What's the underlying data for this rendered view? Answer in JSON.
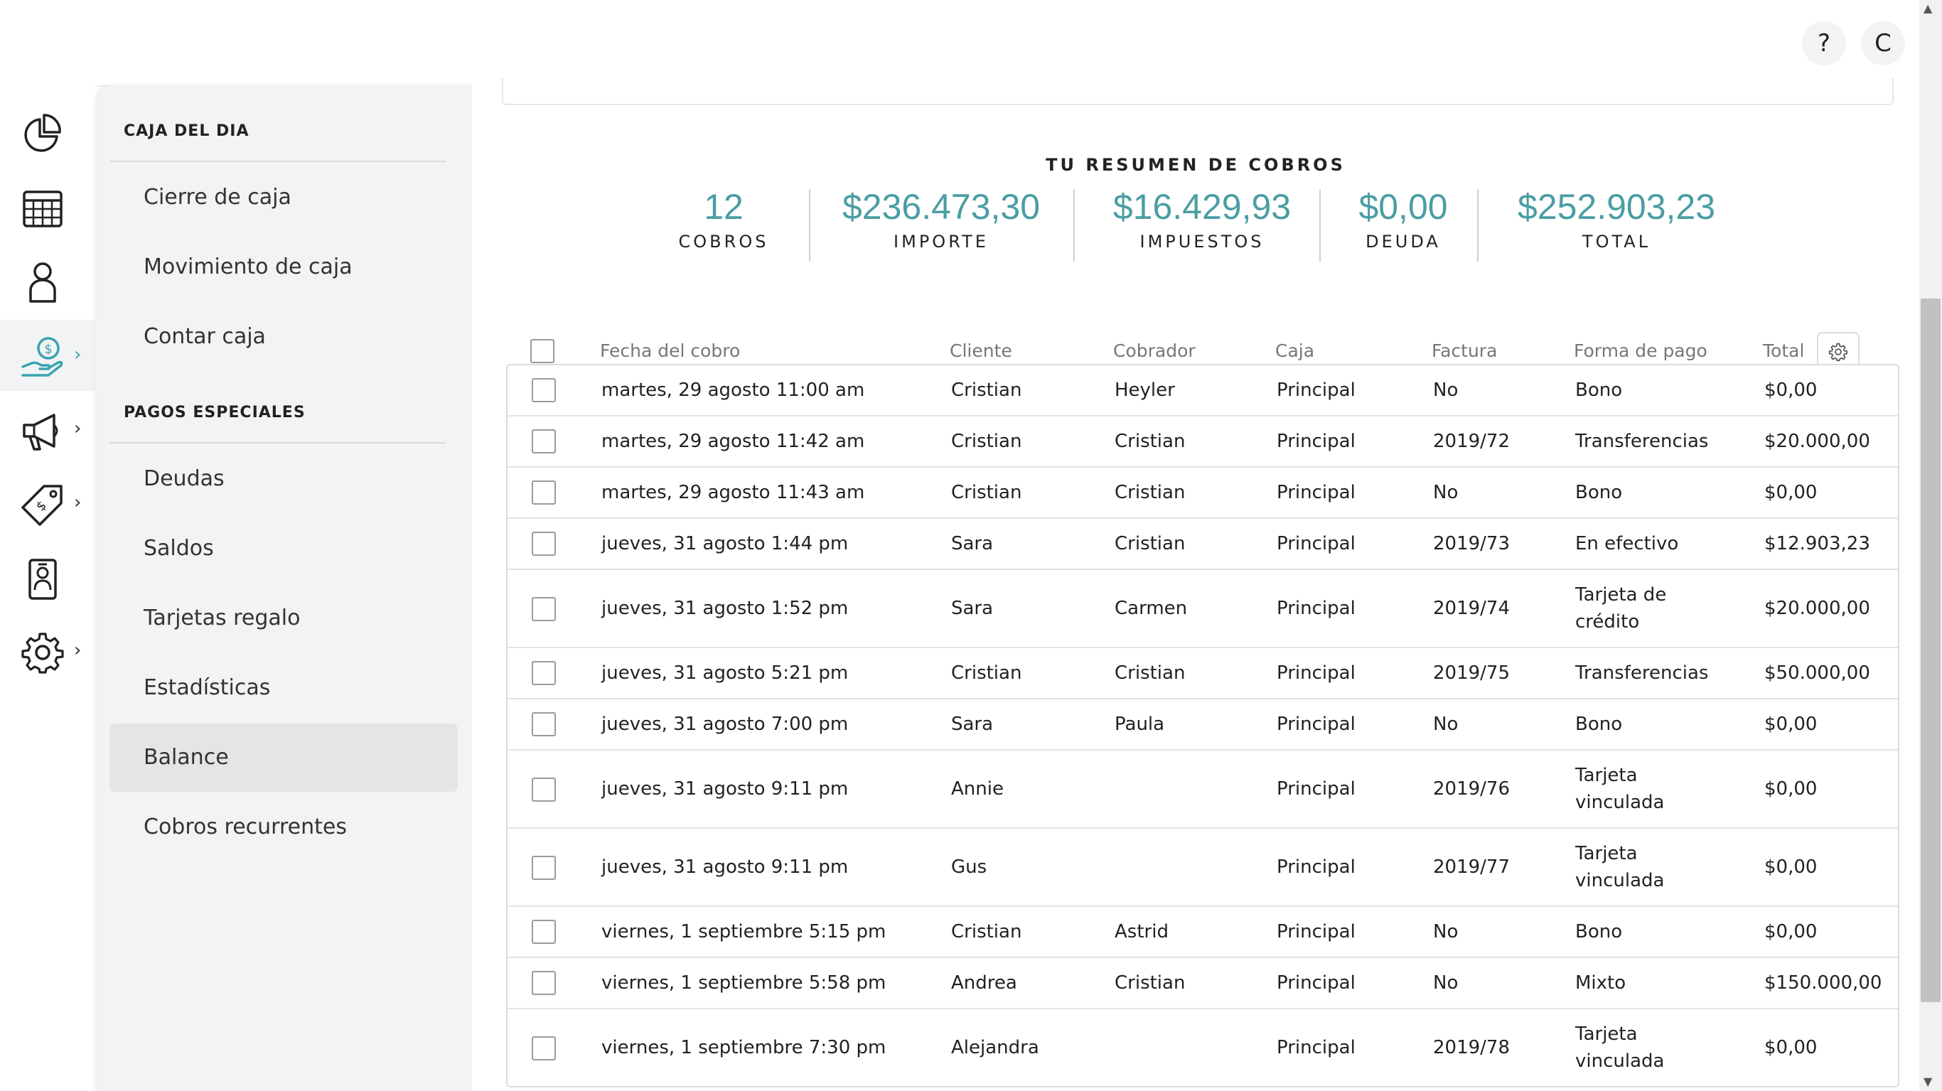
{
  "topbar": {
    "help_label": "?",
    "avatar_letter": "C"
  },
  "rail": {
    "items": [
      {
        "icon": "chart-pie-icon",
        "active": false,
        "has_chevron": false
      },
      {
        "icon": "calendar-icon",
        "active": false,
        "has_chevron": false
      },
      {
        "icon": "user-icon",
        "active": false,
        "has_chevron": false
      },
      {
        "icon": "hand-money-icon",
        "active": true,
        "has_chevron": true
      },
      {
        "icon": "megaphone-icon",
        "active": false,
        "has_chevron": true
      },
      {
        "icon": "price-tag-icon",
        "active": false,
        "has_chevron": true
      },
      {
        "icon": "id-badge-icon",
        "active": false,
        "has_chevron": false
      },
      {
        "icon": "gear-icon",
        "active": false,
        "has_chevron": true
      }
    ],
    "chevron": "›",
    "accent_color": "#3aa3b0"
  },
  "submenu": {
    "section1_title": "CAJA DEL DIA",
    "section1_items": [
      "Cierre de caja",
      "Movimiento de caja",
      "Contar caja"
    ],
    "section2_title": "PAGOS ESPECIALES",
    "section2_items": [
      "Deudas",
      "Saldos",
      "Tarjetas regalo",
      "Estadísticas",
      "Balance",
      "Cobros recurrentes"
    ],
    "active_item": "Balance"
  },
  "summary": {
    "title": "TU RESUMEN DE COBROS",
    "stats": [
      {
        "value": "12",
        "label": "COBROS"
      },
      {
        "value": "$236.473,30",
        "label": "IMPORTE"
      },
      {
        "value": "$16.429,93",
        "label": "IMPUESTOS"
      },
      {
        "value": "$0,00",
        "label": "DEUDA"
      },
      {
        "value": "$252.903,23",
        "label": "TOTAL"
      }
    ],
    "value_color": "#4a9ea3"
  },
  "table": {
    "headers": [
      "Fecha del cobro",
      "Cliente",
      "Cobrador",
      "Caja",
      "Factura",
      "Forma de pago",
      "Total"
    ],
    "rows": [
      {
        "fecha": "martes, 29 agosto 11:00 am",
        "cliente": "Cristian",
        "cobrador": "Heyler",
        "caja": "Principal",
        "factura": "No",
        "forma": "Bono",
        "total": "$0,00"
      },
      {
        "fecha": "martes, 29 agosto 11:42 am",
        "cliente": "Cristian",
        "cobrador": "Cristian",
        "caja": "Principal",
        "factura": "2019/72",
        "forma": "Transferencias",
        "total": "$20.000,00"
      },
      {
        "fecha": "martes, 29 agosto 11:43 am",
        "cliente": "Cristian",
        "cobrador": "Cristian",
        "caja": "Principal",
        "factura": "No",
        "forma": "Bono",
        "total": "$0,00"
      },
      {
        "fecha": "jueves, 31 agosto 1:44 pm",
        "cliente": "Sara",
        "cobrador": "Cristian",
        "caja": "Principal",
        "factura": "2019/73",
        "forma": "En efectivo",
        "total": "$12.903,23"
      },
      {
        "fecha": "jueves, 31 agosto 1:52 pm",
        "cliente": "Sara",
        "cobrador": "Carmen",
        "caja": "Principal",
        "factura": "2019/74",
        "forma": "Tarjeta de crédito",
        "total": "$20.000,00"
      },
      {
        "fecha": "jueves, 31 agosto 5:21 pm",
        "cliente": "Cristian",
        "cobrador": "Cristian",
        "caja": "Principal",
        "factura": "2019/75",
        "forma": "Transferencias",
        "total": "$50.000,00"
      },
      {
        "fecha": "jueves, 31 agosto 7:00 pm",
        "cliente": "Sara",
        "cobrador": "Paula",
        "caja": "Principal",
        "factura": "No",
        "forma": "Bono",
        "total": "$0,00"
      },
      {
        "fecha": "jueves, 31 agosto 9:11 pm",
        "cliente": "Annie",
        "cobrador": "",
        "caja": "Principal",
        "factura": "2019/76",
        "forma": "Tarjeta vinculada",
        "total": "$0,00"
      },
      {
        "fecha": "jueves, 31 agosto 9:11 pm",
        "cliente": "Gus",
        "cobrador": "",
        "caja": "Principal",
        "factura": "2019/77",
        "forma": "Tarjeta vinculada",
        "total": "$0,00"
      },
      {
        "fecha": "viernes, 1 septiembre 5:15 pm",
        "cliente": "Cristian",
        "cobrador": "Astrid",
        "caja": "Principal",
        "factura": "No",
        "forma": "Bono",
        "total": "$0,00"
      },
      {
        "fecha": "viernes, 1 septiembre 5:58 pm",
        "cliente": "Andrea",
        "cobrador": "Cristian",
        "caja": "Principal",
        "factura": "No",
        "forma": "Mixto",
        "total": "$150.000,00"
      },
      {
        "fecha": "viernes, 1 septiembre 7:30 pm",
        "cliente": "Alejandra",
        "cobrador": "",
        "caja": "Principal",
        "factura": "2019/78",
        "forma": "Tarjeta vinculada",
        "total": "$0,00"
      }
    ]
  }
}
